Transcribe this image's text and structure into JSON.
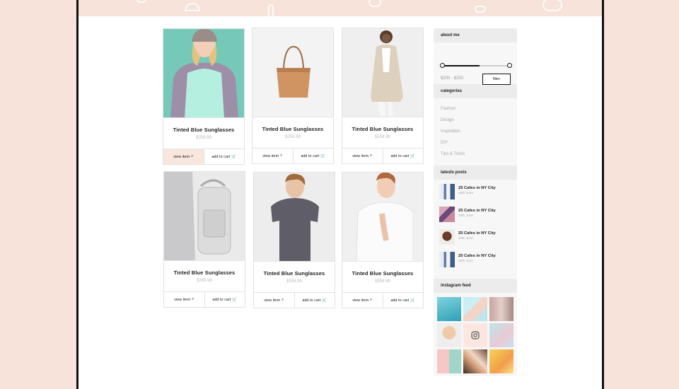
{
  "products": [
    {
      "title": "Tinted Blue Sunglasses",
      "price": "$259.99",
      "view_label": "view item",
      "cart_label": "add to cart"
    },
    {
      "title": "Tinted Blue Sunglasses",
      "price": "$259.99",
      "view_label": "view item",
      "cart_label": "add to cart"
    },
    {
      "title": "Tinted Blue Sunglasses",
      "price": "$259.99",
      "view_label": "view item",
      "cart_label": "add to cart"
    },
    {
      "title": "Tinted Blue Sunglasses",
      "price": "$259.99",
      "view_label": "view item",
      "cart_label": "add to cart"
    },
    {
      "title": "Tinted Blue Sunglasses",
      "price": "$259.99",
      "view_label": "view item",
      "cart_label": "add to cart"
    },
    {
      "title": "Tinted Blue Sunglasses",
      "price": "$259.99",
      "view_label": "view item",
      "cart_label": "add to cart"
    }
  ],
  "sidebar": {
    "about": {
      "title": "about me",
      "range_value": "$200 - $250",
      "filter_label": "filter",
      "slider_fill_fraction": 0.55
    },
    "categories": {
      "title": "categories",
      "items": [
        "Fashion",
        "Design",
        "Inspiration",
        "DIY",
        "Tips & Tricks"
      ]
    },
    "posts": {
      "title": "latests posts",
      "items": [
        {
          "title": "25 Cafes in NY City",
          "date": "25th June"
        },
        {
          "title": "25 Cafes in NY City",
          "date": "25th June"
        },
        {
          "title": "25 Cafes in NY City",
          "date": "25th June"
        },
        {
          "title": "25 Cafes in NY City",
          "date": "25th June"
        }
      ]
    },
    "instagram": {
      "title": "instagram feed"
    }
  },
  "colors": {
    "accent_peach": "#f7e3d9",
    "active_button": "#f9e7de",
    "text_dark": "#222222",
    "muted": "#a7a7a7"
  },
  "icons": {
    "view": "search-icon",
    "cart": "cart-icon",
    "instagram": "instagram-icon"
  }
}
